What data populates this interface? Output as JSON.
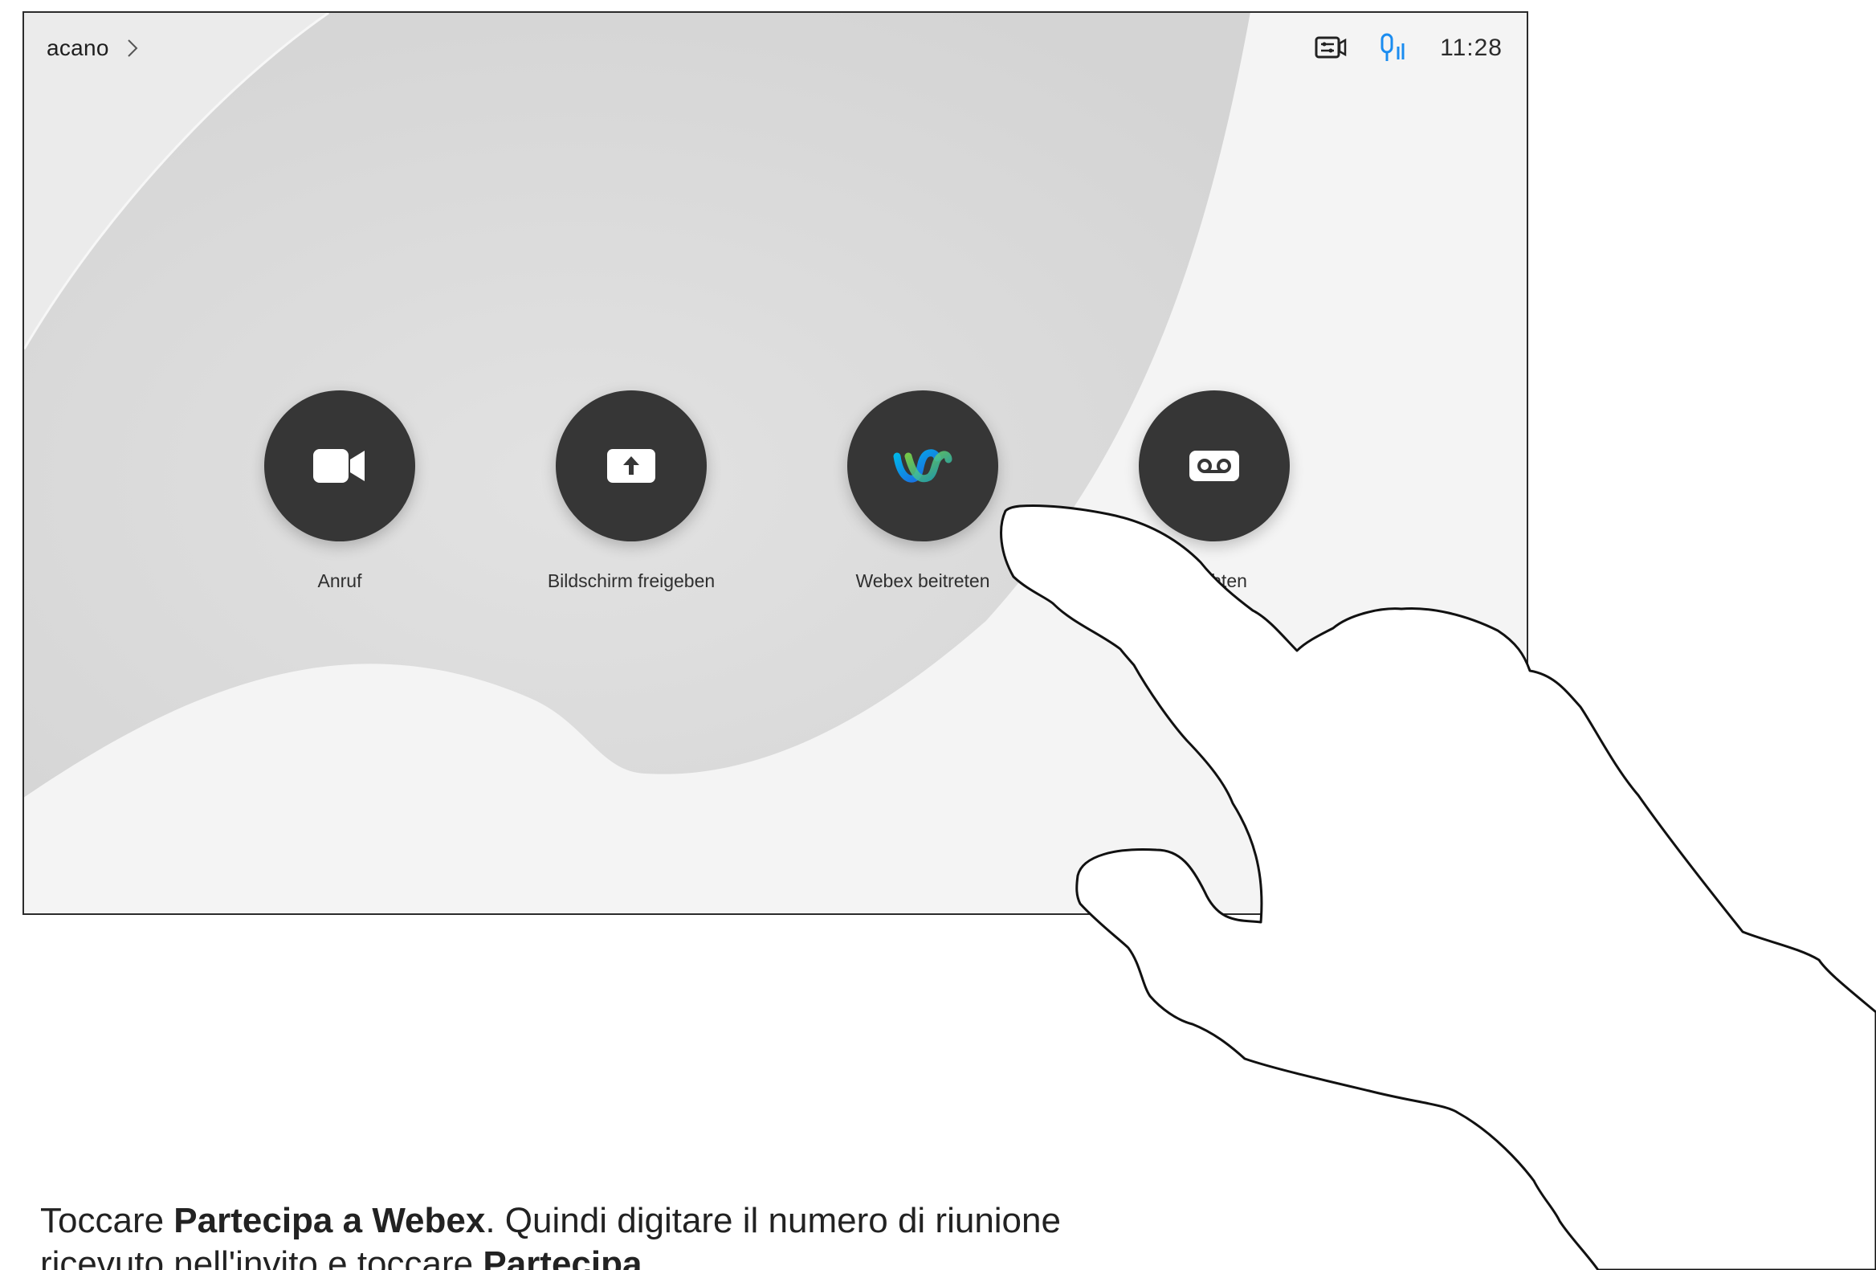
{
  "header": {
    "location_label": "acano",
    "time": "11:28"
  },
  "status_icons": [
    "video-layout-icon",
    "mic-level-icon"
  ],
  "actions": [
    {
      "label": "Anruf",
      "icon": "video-camera-icon"
    },
    {
      "label": "Bildschirm freigeben",
      "icon": "share-screen-icon"
    },
    {
      "label": "Webex beitreten",
      "icon": "webex-icon"
    },
    {
      "label": "hrichten",
      "icon": "voicemail-icon"
    }
  ],
  "instruction": {
    "p1": "Toccare ",
    "b1": "Partecipa a Webex",
    "p2": ". Quindi digitare il numero di riunione ricevuto nell'invito e toccare ",
    "b2": "Partecipa",
    "p3": "."
  },
  "colors": {
    "button": "#363636",
    "mic_accent": "#1a8cf0",
    "text": "#1e1e1e"
  }
}
